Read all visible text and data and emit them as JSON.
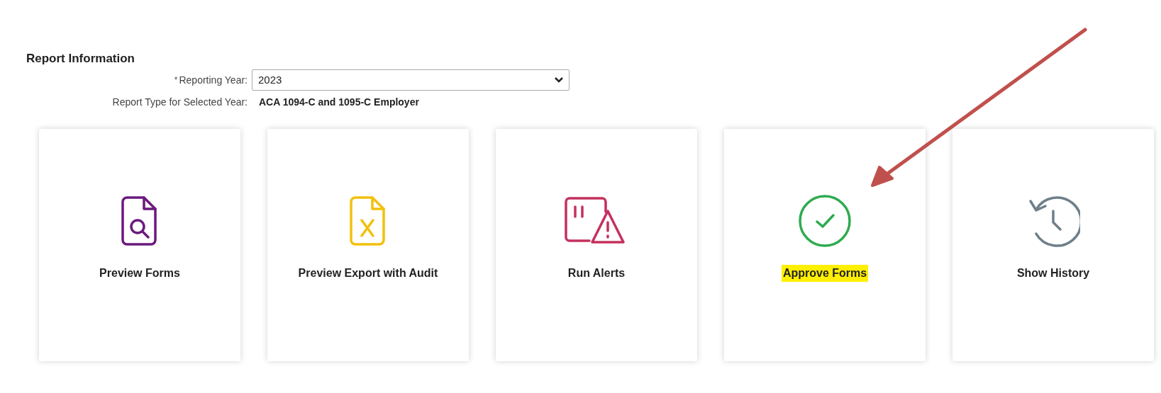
{
  "section_title": "Report Information",
  "fields": [
    {
      "kind": "select",
      "required_mark": "*",
      "label": "Reporting Year:",
      "value": "2023"
    },
    {
      "kind": "text",
      "label": "Report Type for Selected Year:",
      "value": "ACA 1094-C and 1095-C Employer"
    }
  ],
  "tiles": [
    {
      "kind": "preview",
      "label": "Preview Forms",
      "highlighted": false
    },
    {
      "kind": "export",
      "label": "Preview Export with Audit",
      "highlighted": false
    },
    {
      "kind": "alerts",
      "label": "Run Alerts",
      "highlighted": false
    },
    {
      "kind": "approve",
      "label": "Approve Forms",
      "highlighted": true
    },
    {
      "kind": "history",
      "label": "Show History",
      "highlighted": false
    }
  ]
}
